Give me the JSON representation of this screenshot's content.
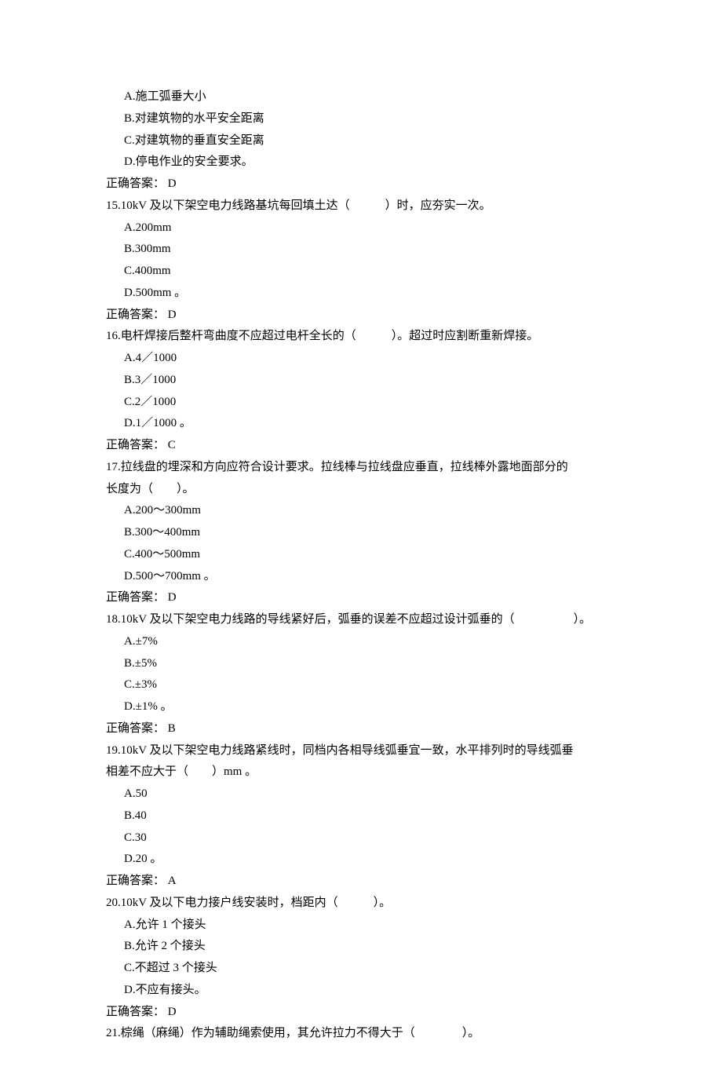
{
  "q14": {
    "optA": "A.施工弧垂大小",
    "optB": "B.对建筑物的水平安全距离",
    "optC": "C.对建筑物的垂直安全距离",
    "optD": "D.停电作业的安全要求。",
    "ans": "正确答案： D"
  },
  "q15": {
    "stem": "15.10kV 及以下架空电力线路基坑每回填土达（　　　）时，应夯实一次。",
    "optA": "A.200mm",
    "optB": "B.300mm",
    "optC": "C.400mm",
    "optD": "D.500mm 。",
    "ans": "正确答案： D"
  },
  "q16": {
    "stem": "16.电杆焊接后整杆弯曲度不应超过电杆全长的（　　　）。超过时应割断重新焊接。",
    "optA": "A.4／1000",
    "optB": "B.3／1000",
    "optC": "C.2／1000",
    "optD": "D.1／1000 。",
    "ans": "正确答案： C"
  },
  "q17": {
    "stem1": "17.拉线盘的埋深和方向应符合设计要求。拉线棒与拉线盘应垂直，拉线棒外露地面部分的",
    "stem2": "长度为（　　）。",
    "optA": "A.200～300mm",
    "optB": "B.300～400mm",
    "optC": "C.400～500mm",
    "optD": "D.500～700mm 。",
    "ans": "正确答案： D"
  },
  "q18": {
    "stem": "18.10kV 及以下架空电力线路的导线紧好后，弧垂的误差不应超过设计弧垂的（　　　　　）。",
    "optA": "A.±7%",
    "optB": "B.±5%",
    "optC": "C.±3%",
    "optD": "D.±1% 。",
    "ans": "正确答案： B"
  },
  "q19": {
    "stem1": "19.10kV 及以下架空电力线路紧线时，同档内各相导线弧垂宜一致，水平排列时的导线弧垂",
    "stem2": "相差不应大于（　　）mm 。",
    "optA": "A.50",
    "optB": "B.40",
    "optC": "C.30",
    "optD": "D.20 。",
    "ans": "正确答案： A"
  },
  "q20": {
    "stem": "20.10kV 及以下电力接户线安装时，档距内（　　　）。",
    "optA": "A.允许 1 个接头",
    "optB": "B.允许 2 个接头",
    "optC": "C.不超过 3 个接头",
    "optD": "D.不应有接头。",
    "ans": "正确答案： D"
  },
  "q21": {
    "stem": "21.棕绳（麻绳）作为辅助绳索使用，其允许拉力不得大于（　　　　）。"
  }
}
